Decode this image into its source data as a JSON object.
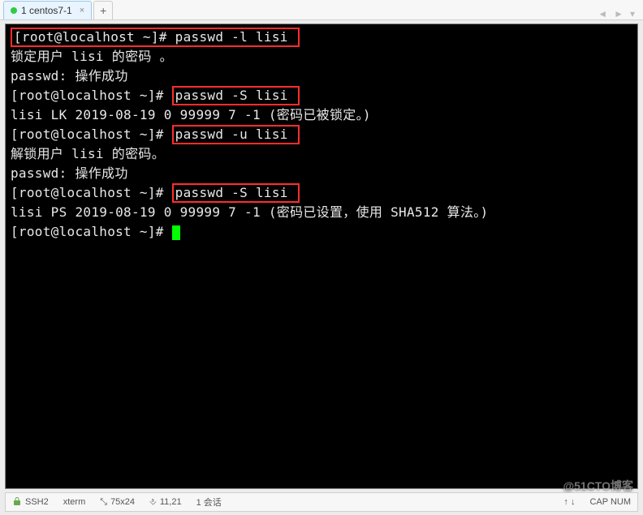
{
  "tab": {
    "title": "1 centos7-1",
    "close_glyph": "×"
  },
  "tab_nav": {
    "prev": "◄",
    "next": "►",
    "menu": "▾"
  },
  "add_tab": "+",
  "terminal": {
    "lines": [
      {
        "prompt": "[root@localhost ~]# ",
        "cmd": "passwd -l lisi ",
        "hl_all": true
      },
      {
        "text": "锁定用户 lisi 的密码 。"
      },
      {
        "text": "passwd: 操作成功"
      },
      {
        "prompt": "[root@localhost ~]# ",
        "cmd": "passwd -S lisi ",
        "hl_cmd": true
      },
      {
        "text": "lisi LK 2019-08-19 0 99999 7 -1 (密码已被锁定。)"
      },
      {
        "prompt": "[root@localhost ~]# ",
        "cmd": "passwd -u lisi ",
        "hl_cmd": true
      },
      {
        "text": "解锁用户 lisi 的密码。"
      },
      {
        "text": "passwd: 操作成功"
      },
      {
        "prompt": "[root@localhost ~]# ",
        "cmd": "passwd -S lisi ",
        "hl_cmd": true
      },
      {
        "text": "lisi PS 2019-08-19 0 99999 7 -1 (密码已设置，使用 SHA512 算法。)"
      },
      {
        "prompt": "[root@localhost ~]# ",
        "cursor": true
      }
    ]
  },
  "status": {
    "conn": "SSH2",
    "term": "xterm",
    "size": "75x24",
    "pos": "11,21",
    "sessions": "1 会话",
    "extra1": "↑ ↓",
    "extra2": "CAP  NUM"
  },
  "watermark": "@51CTO博客"
}
